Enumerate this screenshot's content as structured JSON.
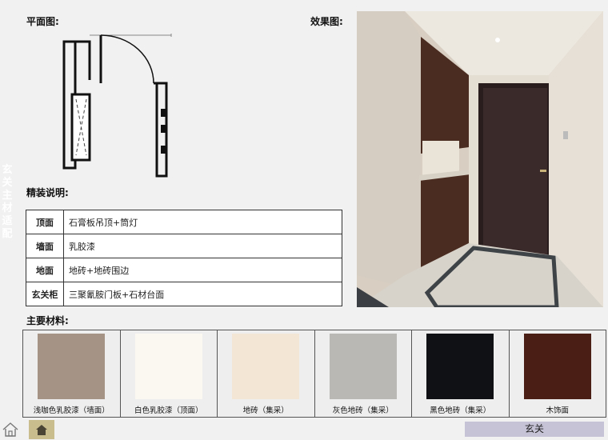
{
  "side_title": "玄关主材适配",
  "labels": {
    "plan": "平面图:",
    "render": "效果图:",
    "spec": "精装说明:",
    "materials": "主要材料:"
  },
  "spec_rows": [
    {
      "key": "顶面",
      "value": "石膏板吊顶+筒灯"
    },
    {
      "key": "墙面",
      "value": "乳胶漆"
    },
    {
      "key": "地面",
      "value": "地砖+地砖围边"
    },
    {
      "key": "玄关柜",
      "value": "三聚氰胺门板+石材台面"
    }
  ],
  "materials": [
    {
      "name": "浅咖色乳胶漆（墙面）",
      "color": "#a59486"
    },
    {
      "name": "白色乳胶漆（顶面）",
      "color": "#faf8f1"
    },
    {
      "name": "地砖（集采）",
      "color": "#f3e6d4"
    },
    {
      "name": "灰色地砖（集采）",
      "color": "#b9b8b5"
    },
    {
      "name": "黑色地砖（集采）",
      "color": "#101114"
    },
    {
      "name": "木饰面",
      "color": "#4a1e14"
    }
  ],
  "nav": {
    "section": "玄关",
    "accent": "#c9bd8e",
    "tab_color": "#c7c3d6"
  }
}
